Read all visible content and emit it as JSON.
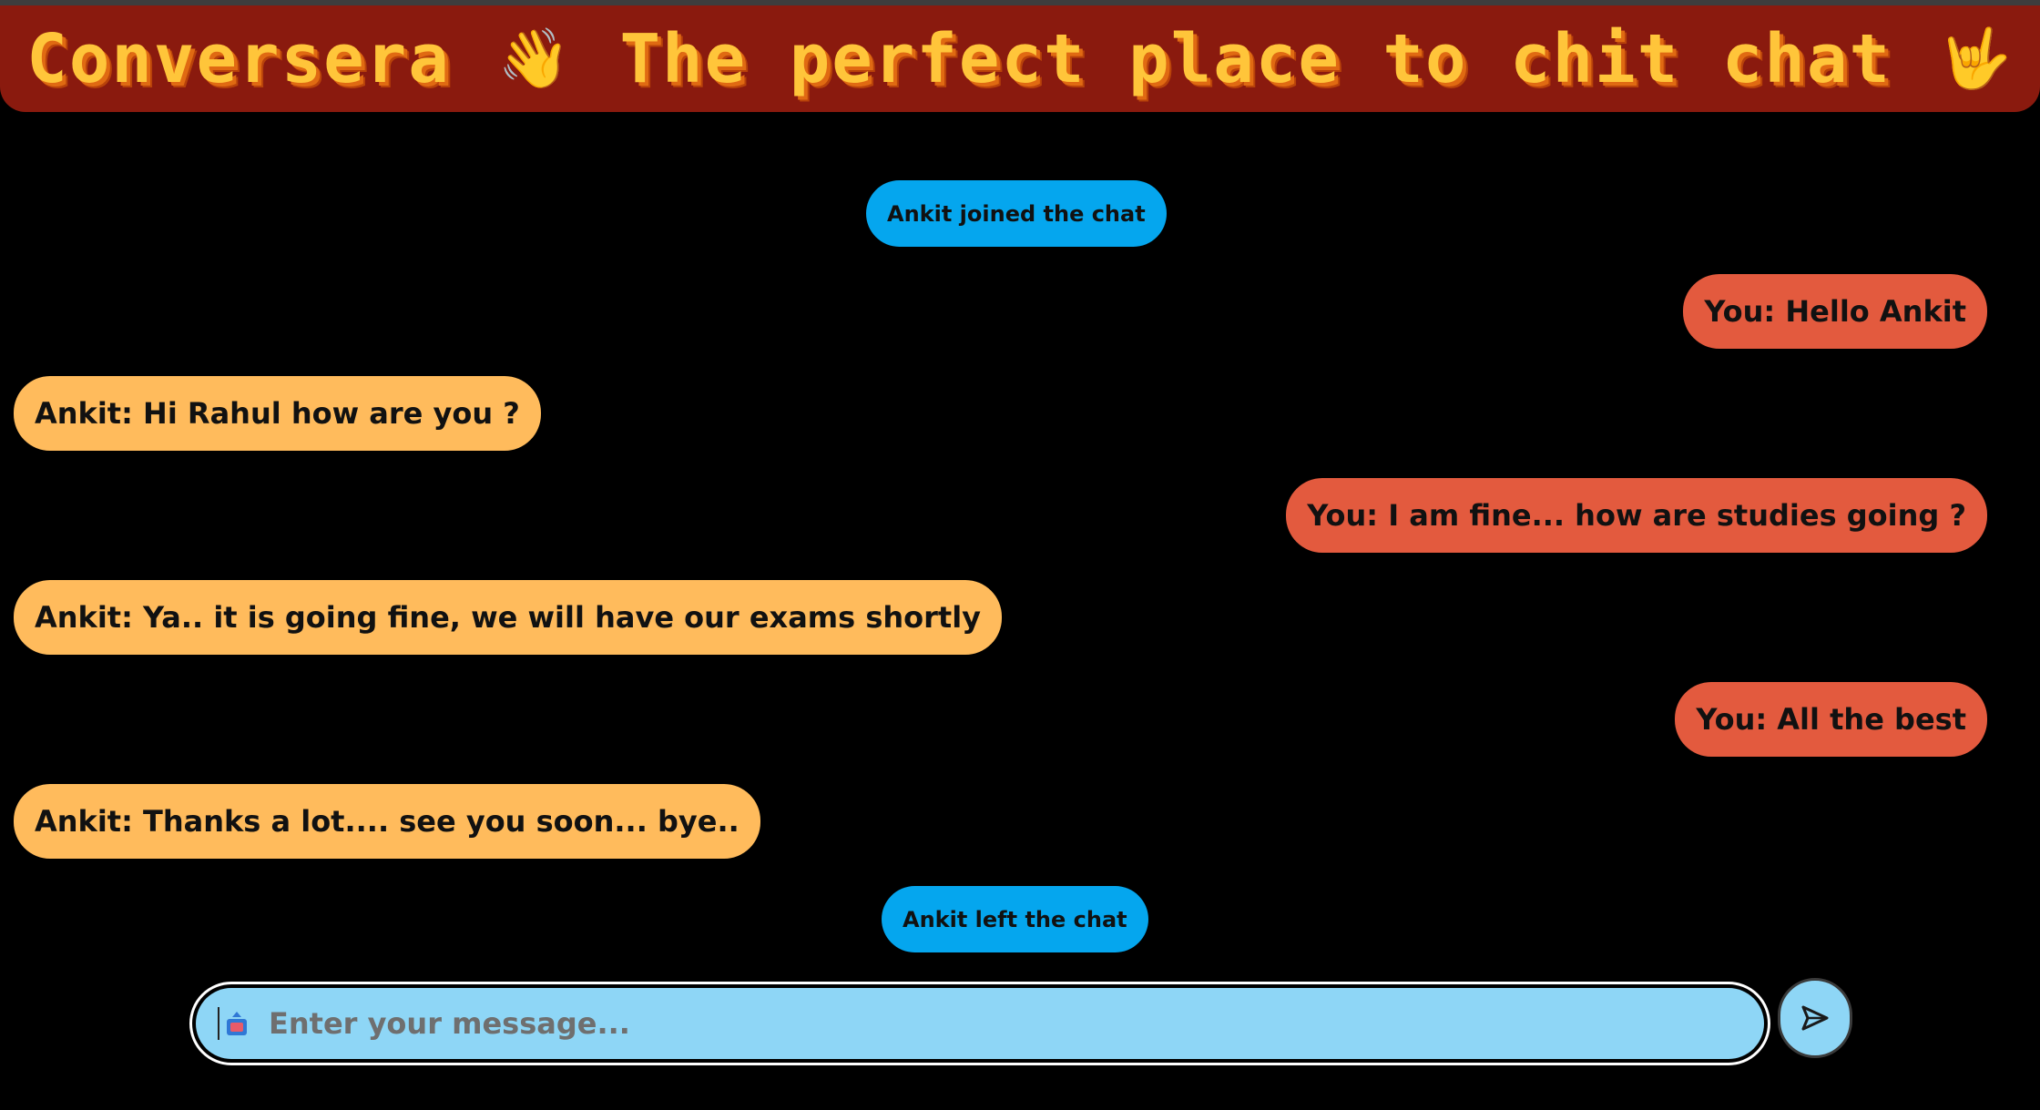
{
  "header": {
    "app_name": "Conversera",
    "tagline": "The perfect place to chit chat",
    "wave_emoji": "👋",
    "hand_emoji": "🤟"
  },
  "messages": [
    {
      "kind": "system",
      "text": "Ankit joined the chat"
    },
    {
      "kind": "outgoing",
      "text": "You: Hello Ankit"
    },
    {
      "kind": "incoming",
      "text": "Ankit: Hi Rahul how are you ?"
    },
    {
      "kind": "outgoing",
      "text": "You: I am fine... how are studies going ?"
    },
    {
      "kind": "incoming",
      "text": "Ankit: Ya.. it is going fine, we will have our exams shortly"
    },
    {
      "kind": "outgoing",
      "text": "You: All the best"
    },
    {
      "kind": "incoming",
      "text": "Ankit: Thanks a lot.... see you soon... bye.."
    },
    {
      "kind": "system",
      "text": "Ankit left the chat"
    }
  ],
  "composer": {
    "placeholder": "Enter your message...",
    "value": "",
    "send_icon": "send-icon",
    "keyboard_icon": "keyboard-icon"
  },
  "colors": {
    "header_bg": "#8a1a0e",
    "title_text": "#ffc53a",
    "system_bubble": "#05a6ee",
    "outgoing_bubble": "#e35a3e",
    "incoming_bubble": "#ffbb5c",
    "input_bg": "#8ed6f6",
    "page_bg": "#000000"
  }
}
